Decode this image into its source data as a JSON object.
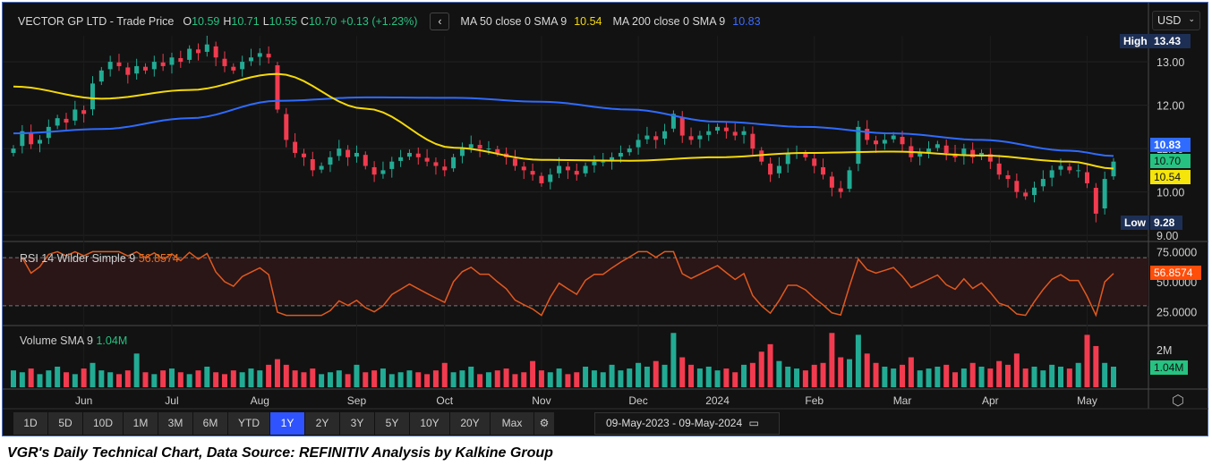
{
  "header": {
    "title": "VECTOR GP LTD - Trade Price",
    "o_label": "O",
    "open": "10.59",
    "h_label": "H",
    "high": "10.71",
    "l_label": "L",
    "low": "10.55",
    "c_label": "C",
    "close": "10.70",
    "change": "+0.13 (+1.23%)",
    "ma50_label": "MA 50 close 0 SMA 9",
    "ma50_value": "10.54",
    "ma200_label": "MA 200 close 0 SMA 9",
    "ma200_value": "10.83"
  },
  "currency": "USD",
  "toolbar": {
    "ranges": [
      "1D",
      "5D",
      "10D",
      "1M",
      "3M",
      "6M",
      "YTD",
      "1Y",
      "2Y",
      "3Y",
      "5Y",
      "10Y",
      "20Y",
      "Max"
    ],
    "active": "1Y",
    "date_from": "09-May-2023",
    "date_sep": "-",
    "date_to": "09-May-2024"
  },
  "caption": "VGR's Daily Technical Chart, Data Source: REFINITIV Analysis by Kalkine Group",
  "colors": {
    "up": "#22ab94",
    "down": "#f23b4f",
    "ma50": "#f5d90a",
    "ma200": "#2f6bff",
    "rsi": "#e05a1e"
  },
  "chart_data": {
    "type": "candlestick",
    "x_labels": [
      "Jun",
      "Jul",
      "Aug",
      "Sep",
      "Oct",
      "Nov",
      "Dec",
      "2024",
      "Feb",
      "Mar",
      "Apr",
      "May"
    ],
    "x_label_index": [
      8,
      18,
      28,
      39,
      49,
      60,
      71,
      80,
      91,
      101,
      111,
      122
    ],
    "price": {
      "ylim": [
        8.9,
        13.6
      ],
      "ticks": [
        "9.00",
        "10.00",
        "11.00",
        "12.00",
        "13.00"
      ],
      "tick_values": [
        9,
        10,
        11,
        12,
        13
      ],
      "high_label": "High",
      "high_value": "13.43",
      "low_label": "Low",
      "low_value": "9.28",
      "last_ma200": "10.83",
      "last_close": "10.70",
      "last_ma50": "10.54",
      "close": [
        11.0,
        11.4,
        11.1,
        11.2,
        11.5,
        11.7,
        11.6,
        11.9,
        11.8,
        12.5,
        12.8,
        13.0,
        12.9,
        12.7,
        12.9,
        12.8,
        13.0,
        12.9,
        13.1,
        13.0,
        13.3,
        13.2,
        13.4,
        13.1,
        12.9,
        12.8,
        13.0,
        13.1,
        13.2,
        13.1,
        11.9,
        11.2,
        10.9,
        10.8,
        10.5,
        10.6,
        10.8,
        11.0,
        10.8,
        10.9,
        10.6,
        10.4,
        10.5,
        10.7,
        10.8,
        10.9,
        10.8,
        10.7,
        10.6,
        10.5,
        10.8,
        11.0,
        11.1,
        11.0,
        11.0,
        10.9,
        10.8,
        10.6,
        10.5,
        10.4,
        10.2,
        10.4,
        10.6,
        10.5,
        10.4,
        10.6,
        10.7,
        10.7,
        10.8,
        10.9,
        11.0,
        11.2,
        11.3,
        11.2,
        11.4,
        11.8,
        11.3,
        11.2,
        11.3,
        11.4,
        11.5,
        11.4,
        11.3,
        11.4,
        11.0,
        10.7,
        10.4,
        10.6,
        10.9,
        10.9,
        10.8,
        10.6,
        10.4,
        10.1,
        10.0,
        10.5,
        11.5,
        11.2,
        11.1,
        11.2,
        11.3,
        11.1,
        10.8,
        10.9,
        11.0,
        11.1,
        10.9,
        10.8,
        11.0,
        10.8,
        10.9,
        10.7,
        10.4,
        10.3,
        10.0,
        9.9,
        10.1,
        10.3,
        10.5,
        10.6,
        10.5,
        10.5,
        10.2,
        9.5,
        10.3,
        10.7
      ],
      "ma50_keys": [
        [
          0,
          12.43
        ],
        [
          10,
          12.15
        ],
        [
          20,
          12.35
        ],
        [
          30,
          12.72
        ],
        [
          40,
          11.92
        ],
        [
          50,
          11.02
        ],
        [
          60,
          10.74
        ],
        [
          70,
          10.72
        ],
        [
          80,
          10.8
        ],
        [
          90,
          10.9
        ],
        [
          100,
          10.93
        ],
        [
          110,
          10.84
        ],
        [
          120,
          10.7
        ],
        [
          125,
          10.54
        ]
      ],
      "ma200_keys": [
        [
          0,
          11.35
        ],
        [
          10,
          11.45
        ],
        [
          20,
          11.7
        ],
        [
          30,
          12.1
        ],
        [
          40,
          12.18
        ],
        [
          50,
          12.17
        ],
        [
          60,
          12.08
        ],
        [
          70,
          11.9
        ],
        [
          80,
          11.62
        ],
        [
          90,
          11.5
        ],
        [
          100,
          11.35
        ],
        [
          110,
          11.2
        ],
        [
          120,
          10.95
        ],
        [
          125,
          10.83
        ]
      ]
    },
    "rsi": {
      "label": "RSI 14 Wilder Simple 9",
      "value": "56.8574",
      "ticks": [
        "75.0000",
        "50.0000",
        "25.0000"
      ],
      "tick_values": [
        75,
        50,
        25
      ],
      "ylim": [
        15,
        82
      ]
    },
    "volume": {
      "label": "Volume SMA 9",
      "value": "1.04M",
      "tick": "2M",
      "tick_value": 2,
      "ylim": [
        0,
        3.2
      ],
      "values_m": [
        0.9,
        0.8,
        1.0,
        0.7,
        0.9,
        1.1,
        0.8,
        0.7,
        1.0,
        1.3,
        0.9,
        0.8,
        0.7,
        0.9,
        1.8,
        0.8,
        0.7,
        0.9,
        1.0,
        0.8,
        0.7,
        0.9,
        1.1,
        0.8,
        0.7,
        0.9,
        0.8,
        1.0,
        0.9,
        1.2,
        1.5,
        1.2,
        0.9,
        0.8,
        1.0,
        0.7,
        0.8,
        0.9,
        0.7,
        1.2,
        0.8,
        0.9,
        1.0,
        0.7,
        0.8,
        0.9,
        0.8,
        0.7,
        0.9,
        1.3,
        0.8,
        0.9,
        1.1,
        0.7,
        0.8,
        0.9,
        1.0,
        0.7,
        0.8,
        1.4,
        0.9,
        0.8,
        1.0,
        0.7,
        0.8,
        1.1,
        0.9,
        0.8,
        1.2,
        0.9,
        1.0,
        1.3,
        1.1,
        1.4,
        1.2,
        2.9,
        1.6,
        1.2,
        1.0,
        1.1,
        0.9,
        1.0,
        0.8,
        1.2,
        1.3,
        1.9,
        2.3,
        1.4,
        1.1,
        1.0,
        0.9,
        1.2,
        1.3,
        2.9,
        1.6,
        1.5,
        2.8,
        1.8,
        1.3,
        1.1,
        1.0,
        1.2,
        1.6,
        0.9,
        1.0,
        1.1,
        1.2,
        0.8,
        1.0,
        1.3,
        1.1,
        1.0,
        1.4,
        1.2,
        1.8,
        1.0,
        1.1,
        0.9,
        1.2,
        1.1,
        1.0,
        1.3,
        2.8,
        2.2,
        1.3,
        1.1
      ]
    }
  }
}
